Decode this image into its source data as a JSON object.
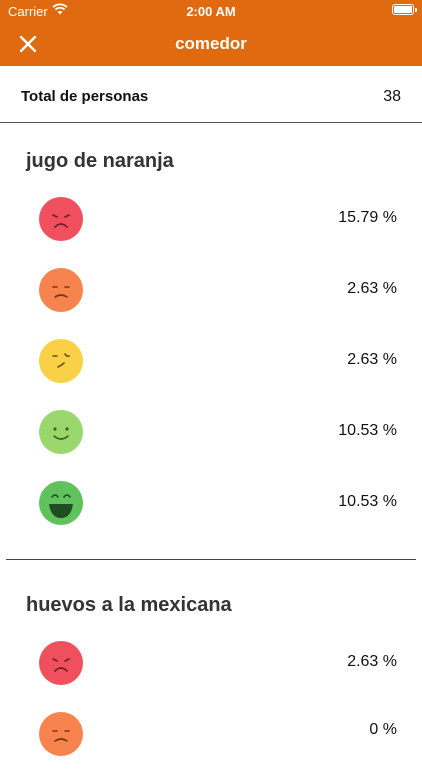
{
  "status_bar": {
    "carrier": "Carrier",
    "time": "2:00 AM"
  },
  "nav": {
    "title": "comedor"
  },
  "total": {
    "label": "Total de personas",
    "value": "38"
  },
  "colors": {
    "accent": "#e06a10",
    "very_bad": "#f0505e",
    "bad": "#f7834f",
    "neutral": "#f9d046",
    "good": "#9ad86e",
    "very_good": "#5fc25d"
  },
  "sections": [
    {
      "title": "jugo de naranja",
      "ratings": [
        {
          "face": "very-sad-face-icon",
          "value": "15.79 %"
        },
        {
          "face": "sad-face-icon",
          "value": "2.63 %"
        },
        {
          "face": "neutral-face-icon",
          "value": "2.63 %"
        },
        {
          "face": "smile-face-icon",
          "value": "10.53 %"
        },
        {
          "face": "big-smile-face-icon",
          "value": "10.53 %"
        }
      ]
    },
    {
      "title": "huevos a la mexicana",
      "ratings": [
        {
          "face": "very-sad-face-icon",
          "value": "2.63 %"
        },
        {
          "face": "sad-face-icon",
          "value": "0 %"
        }
      ]
    }
  ]
}
